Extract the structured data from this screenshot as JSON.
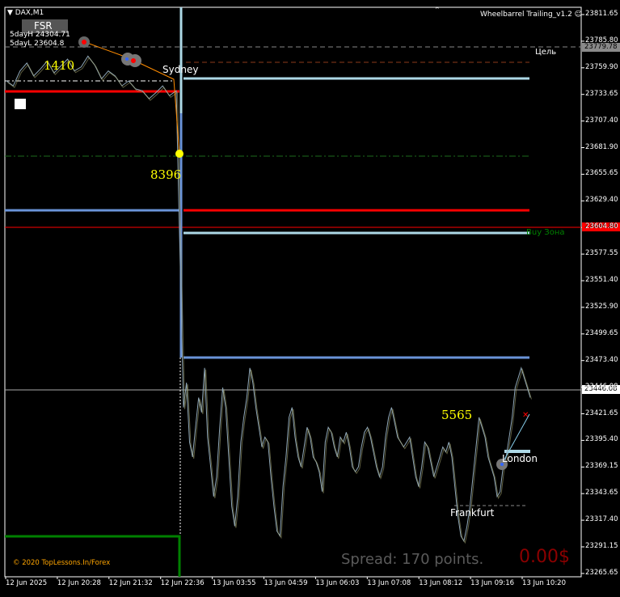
{
  "header": {
    "symbol": "DAX,M1",
    "fsr_label": "FSR",
    "day_high": "5dayH 24304.71",
    "day_low": "5dayL 23604.8",
    "indicator": "Wheelbarrel Trailing_v1.2"
  },
  "labels": {
    "num_1410": "1410",
    "num_8396": "8396",
    "num_5565": "5565",
    "sydney": "Sydney",
    "london": "London",
    "frankfurt": "Frankfurt",
    "target": "Цель",
    "buy_zone": "Buy Зона",
    "copyright": "© 2020 TopLessons.In/Forex",
    "spread": "Spread: 170 points.",
    "profit": "0.00$"
  },
  "price_tags": {
    "target_price": "23779.78",
    "buy_price": "23604.80",
    "current_price": "23446.08"
  },
  "colors": {
    "background": "#000000",
    "candles": "#8fa7b8",
    "light_blue": "#add8e6",
    "cornflower": "#6a93d8",
    "red": "#ff0000",
    "green": "#008000",
    "yellow": "#ffff00"
  },
  "chart_data": {
    "type": "line",
    "symbol": "DAX",
    "timeframe": "M1",
    "y_ticks": [
      "23811.65",
      "23785.80",
      "23759.90",
      "23733.65",
      "23707.40",
      "23681.90",
      "23655.65",
      "23629.40",
      "23604.80",
      "23577.55",
      "23551.40",
      "23525.90",
      "23499.65",
      "23473.40",
      "23446.08",
      "23421.65",
      "23395.40",
      "23369.15",
      "23343.65",
      "23317.40",
      "23291.15",
      "23265.65"
    ],
    "x_ticks": [
      "12 Jun 2025",
      "12 Jun 20:28",
      "12 Jun 21:32",
      "12 Jun 22:36",
      "13 Jun 03:55",
      "13 Jun 04:59",
      "13 Jun 06:03",
      "13 Jun 07:08",
      "13 Jun 08:12",
      "13 Jun 09:16",
      "13 Jun 10:20"
    ],
    "ylim": [
      23263,
      23827
    ],
    "series": [
      {
        "values": [
          23760,
          23755,
          23770,
          23778,
          23765,
          23772,
          23780,
          23768,
          23775,
          23782,
          23770,
          23774,
          23785,
          23776,
          23762,
          23770,
          23765,
          23755,
          23760,
          23752,
          23750,
          23742,
          23748,
          23755,
          23745,
          23750,
          23430,
          23455,
          23395,
          23380,
          23410,
          23440,
          23425,
          23470,
          23400,
          23370,
          23340,
          23360,
          23410,
          23450,
          23430,
          23380,
          23330,
          23310,
          23340,
          23395,
          23420,
          23440,
          23470,
          23455,
          23430,
          23410,
          23390,
          23400,
          23395,
          23360,
          23330,
          23305,
          23300,
          23350,
          23380,
          23420,
          23430,
          23400,
          23380,
          23370,
          23390,
          23410,
          23400,
          23380,
          23375,
          23365,
          23345,
          23395,
          23410,
          23405,
          23390,
          23380,
          23400,
          23395,
          23405,
          23390,
          23370,
          23365,
          23370,
          23390,
          23405,
          23410,
          23400,
          23385,
          23370,
          23360,
          23370,
          23400,
          23420,
          23430,
          23415,
          23400,
          23395,
          23390,
          23395,
          23400,
          23380,
          23360,
          23350,
          23370,
          23395,
          23390,
          23375,
          23360,
          23370,
          23380,
          23390,
          23385,
          23395,
          23380,
          23350,
          23320,
          23300,
          23295,
          23310,
          23330,
          23360,
          23390,
          23420,
          23410,
          23400,
          23380,
          23370,
          23360,
          23340,
          23345,
          23370,
          23380,
          23400,
          23420,
          23450,
          23460,
          23470,
          23460,
          23450,
          23440
        ]
      }
    ]
  }
}
